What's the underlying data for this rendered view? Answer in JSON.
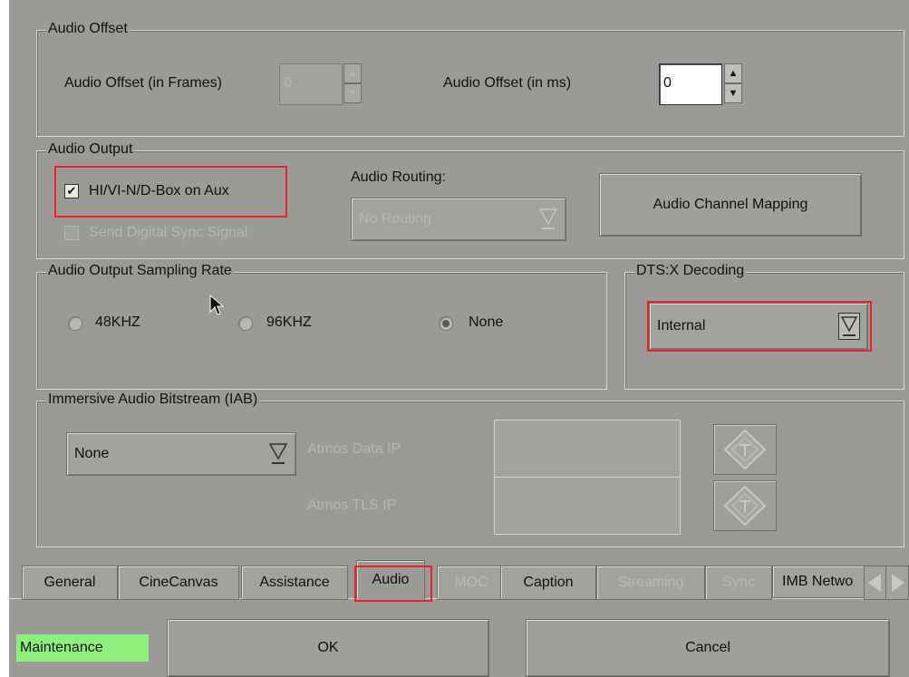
{
  "audio_offset": {
    "title": "Audio Offset",
    "frames_label": "Audio Offset (in Frames)",
    "frames_value": "0",
    "ms_label": "Audio Offset (in ms)",
    "ms_value": "0"
  },
  "audio_output": {
    "title": "Audio Output",
    "hi_vi_label": "HI/VI-N/D-Box on Aux",
    "hi_vi_checked": true,
    "digital_sync_label": "Send Digital Sync Signal",
    "digital_sync_checked": false,
    "routing_label": "Audio Routing:",
    "routing_value": "No Routing",
    "mapping_button": "Audio Channel Mapping"
  },
  "sampling_rate": {
    "title": "Audio Output Sampling Rate",
    "options": [
      "48KHZ",
      "96KHZ",
      "None"
    ],
    "selected": "None"
  },
  "dtsx": {
    "title": "DTS:X Decoding",
    "value": "Internal"
  },
  "iab": {
    "title": "Immersive Audio Bitstream (IAB)",
    "value": "None",
    "atmos_data_ip_label": "Atmos Data IP",
    "atmos_tls_ip_label": "Atmos TLS IP",
    "atmos_data_ip_value": "",
    "atmos_tls_ip_value": ""
  },
  "tabs": [
    {
      "label": "General",
      "enabled": true,
      "active": false
    },
    {
      "label": "CineCanvas",
      "enabled": true,
      "active": false
    },
    {
      "label": "Assistance",
      "enabled": true,
      "active": false
    },
    {
      "label": "Audio",
      "enabled": true,
      "active": true
    },
    {
      "label": "MOC",
      "enabled": false,
      "active": false
    },
    {
      "label": "Caption",
      "enabled": true,
      "active": false
    },
    {
      "label": "Streaming",
      "enabled": false,
      "active": false
    },
    {
      "label": "Sync",
      "enabled": false,
      "active": false
    },
    {
      "label": "IMB Netwo",
      "enabled": true,
      "active": false
    }
  ],
  "footer": {
    "mode_badge": "Maintenance",
    "ok_label": "OK",
    "cancel_label": "Cancel"
  },
  "colors": {
    "panel_bg": "#9b9a96",
    "highlight": "#e8232a",
    "mode_badge_bg": "#8ef07c"
  },
  "icons": {
    "dropdown": "triangle-down-icon",
    "spinner": "up-down-arrows-icon",
    "ip_edit": "diamond-arrow-icon",
    "tab_scroll": "left-right-arrows-icon"
  }
}
